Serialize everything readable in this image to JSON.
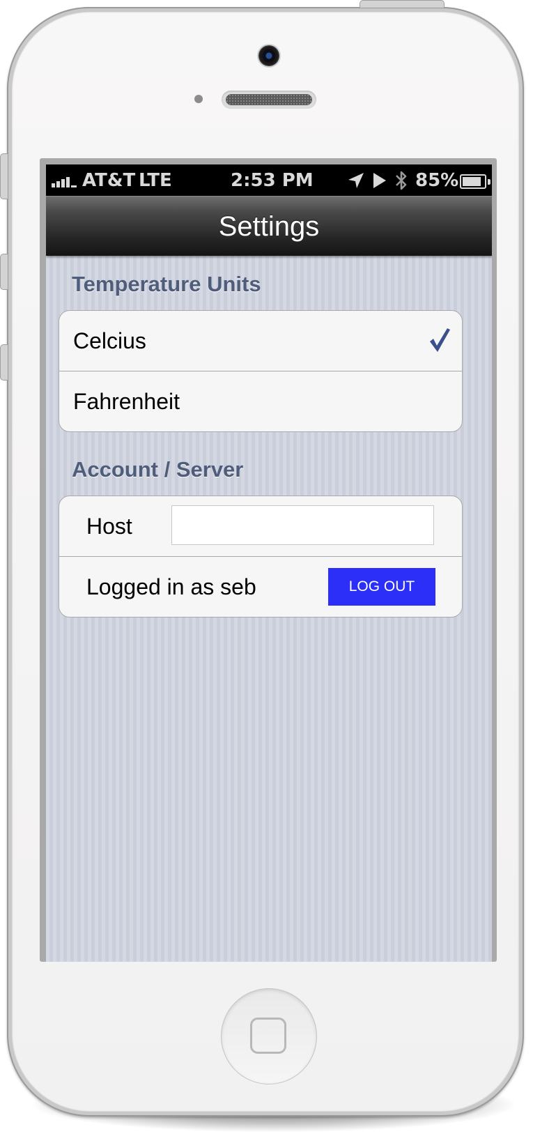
{
  "status_bar": {
    "carrier": "AT&T",
    "network": "LTE",
    "time": "2:53 PM",
    "battery": "85%",
    "icons": [
      "signal-bars-icon",
      "location-arrow-icon",
      "play-icon",
      "bluetooth-icon",
      "battery-icon"
    ]
  },
  "navbar": {
    "title": "Settings"
  },
  "temperature": {
    "header": "Temperature Units",
    "options": [
      {
        "label": "Celcius",
        "selected": true
      },
      {
        "label": "Fahrenheit",
        "selected": false
      }
    ],
    "check_color": "#3b4f8a"
  },
  "account": {
    "header": "Account / Server",
    "host_label": "Host",
    "host_value": "",
    "logged_in_text": "Logged in as seb",
    "logout_label": "LOG OUT",
    "logout_color": "#2b2ff7"
  },
  "device": {
    "home_button_icon": "home-square-icon"
  }
}
